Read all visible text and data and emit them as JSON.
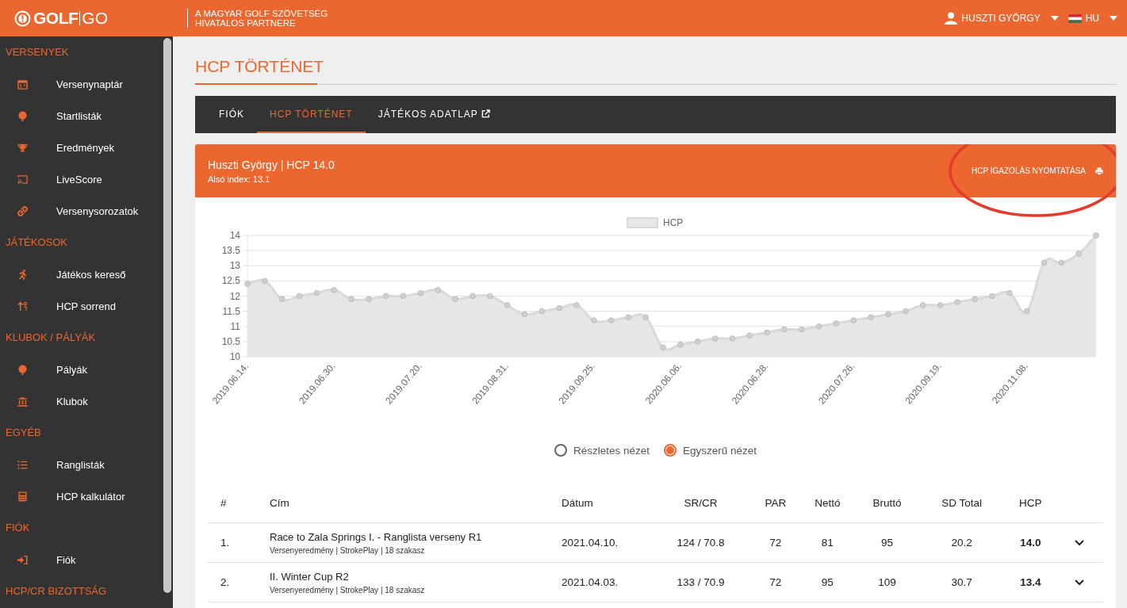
{
  "header": {
    "logo": {
      "bold": "GOLF",
      "light": "GO"
    },
    "partner": [
      "A MAGYAR GOLF SZÖVETSÉG",
      "HIVATALOS PARTNERE"
    ],
    "user": "HUSZTI GYÖRGY",
    "language": "HU"
  },
  "sidebar": {
    "sections": [
      {
        "title": "VERSENYEK",
        "items": [
          {
            "label": "Versenynaptár"
          },
          {
            "label": "Startlisták"
          },
          {
            "label": "Eredmények"
          },
          {
            "label": "LiveScore"
          },
          {
            "label": "Versenysorozatok"
          }
        ]
      },
      {
        "title": "JÁTÉKOSOK",
        "items": [
          {
            "label": "Játékos kereső"
          },
          {
            "label": "HCP sorrend"
          }
        ]
      },
      {
        "title": "KLUBOK / PÁLYÁK",
        "items": [
          {
            "label": "Pályák"
          },
          {
            "label": "Klubok"
          }
        ]
      },
      {
        "title": "EGYÉB",
        "items": [
          {
            "label": "Ranglisták"
          },
          {
            "label": "HCP kalkulátor"
          }
        ]
      },
      {
        "title": "FIÓK",
        "items": [
          {
            "label": "Fiók"
          }
        ]
      },
      {
        "title": "HCP/CR BIZOTTSÁG"
      }
    ]
  },
  "page_title": "HCP TÖRTÉNET",
  "tabs": [
    {
      "label": "FIÓK",
      "selected": false,
      "external": false
    },
    {
      "label": "HCP TÖRTÉNET",
      "selected": true,
      "external": false
    },
    {
      "label": "JÁTÉKOS ADATLAP",
      "selected": false,
      "external": true
    }
  ],
  "card": {
    "name": "Huszti György | HCP 14.0",
    "lower_index": "Alsó index: 13.1",
    "print_button": "HCP IGAZOLÁS NYOMTATÁSA"
  },
  "chart_data": {
    "type": "area",
    "grid": true,
    "ylim": [
      10,
      14
    ],
    "yticks": [
      10,
      10.5,
      11,
      11.5,
      12,
      12.5,
      13,
      13.5,
      14
    ],
    "categories": [
      "2019.06.14.",
      null,
      null,
      null,
      null,
      "2019.06.30.",
      null,
      null,
      null,
      null,
      "2019.07.20.",
      null,
      null,
      null,
      null,
      "2019.08.31.",
      null,
      null,
      null,
      null,
      "2019.09.25.",
      null,
      null,
      null,
      null,
      "2020.06.06.",
      null,
      null,
      null,
      null,
      "2020.06.28.",
      null,
      null,
      null,
      null,
      "2020.07.26.",
      null,
      null,
      null,
      null,
      "2020.09.19.",
      null,
      null,
      null,
      null,
      "2020.11.08.",
      null,
      null,
      null,
      null
    ],
    "series": [
      {
        "name": "HCP",
        "color": "#d9d9d9",
        "values": [
          12.4,
          12.5,
          11.9,
          12.0,
          12.1,
          12.2,
          11.9,
          11.9,
          12.0,
          12.0,
          12.1,
          12.2,
          11.9,
          12.0,
          12.0,
          11.7,
          11.4,
          11.5,
          11.6,
          11.7,
          11.2,
          11.2,
          11.3,
          11.3,
          10.3,
          10.4,
          10.5,
          10.6,
          10.6,
          10.7,
          10.8,
          10.9,
          10.9,
          11.0,
          11.1,
          11.2,
          11.3,
          11.4,
          11.5,
          11.7,
          11.7,
          11.8,
          11.9,
          12.0,
          12.1,
          11.5,
          13.1,
          13.1,
          13.4,
          14.0
        ]
      }
    ]
  },
  "view_options": [
    {
      "label": "Részletes nézet",
      "selected": false
    },
    {
      "label": "Egyszerű nézet",
      "selected": true
    }
  ],
  "table": {
    "columns": [
      "#",
      "Cím",
      "Dátum",
      "SR/CR",
      "PAR",
      "Nettó",
      "Bruttó",
      "SD Total",
      "HCP"
    ],
    "rows": [
      {
        "rank": "1.",
        "title": "Race to Zala Springs I. - Ranglista verseny R1",
        "subtitle": "Versenyeredmény | StrokePlay | 18 szakasz",
        "date": "2021.04.10.",
        "sr_cr": "124 / 70.8",
        "par": "72",
        "netto": "81",
        "brutto": "95",
        "sd_total": "20.2",
        "hcp": "14.0"
      },
      {
        "rank": "2.",
        "title": "II. Winter Cup R2",
        "subtitle": "Versenyeredmény | StrokePlay | 18 szakasz",
        "date": "2021.04.03.",
        "sr_cr": "133 / 70.9",
        "par": "72",
        "netto": "95",
        "brutto": "109",
        "sd_total": "30.7",
        "hcp": "13.4"
      }
    ]
  }
}
